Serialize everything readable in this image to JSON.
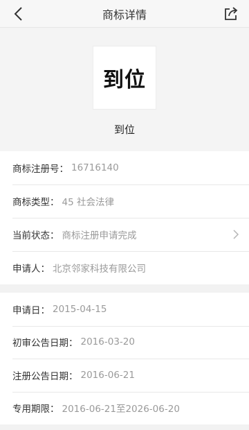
{
  "nav": {
    "title": "商标详情",
    "back_icon": "chevron-left-icon",
    "share_icon": "share-icon"
  },
  "hero": {
    "logo_text": "到位",
    "name": "到位"
  },
  "info": {
    "reg_no": {
      "label": "商标注册号：",
      "value": "16716140"
    },
    "type": {
      "label": "商标类型：",
      "value": "45 社会法律"
    },
    "status": {
      "label": "当前状态：",
      "value": "商标注册申请完成"
    },
    "applicant": {
      "label": "申请人：",
      "value": "北京邻家科技有限公司"
    }
  },
  "dates": {
    "apply": {
      "label": "申请日：",
      "value": "2015-04-15"
    },
    "prelim": {
      "label": "初审公告日期：",
      "value": "2016-03-20"
    },
    "register": {
      "label": "注册公告日期：",
      "value": "2016-06-21"
    },
    "term": {
      "label": "专用期限：",
      "value": "2016-06-21至2026-06-20"
    }
  },
  "colors": {
    "label": "#333333",
    "value": "#9a9a9a",
    "background": "#f2f2f2"
  }
}
